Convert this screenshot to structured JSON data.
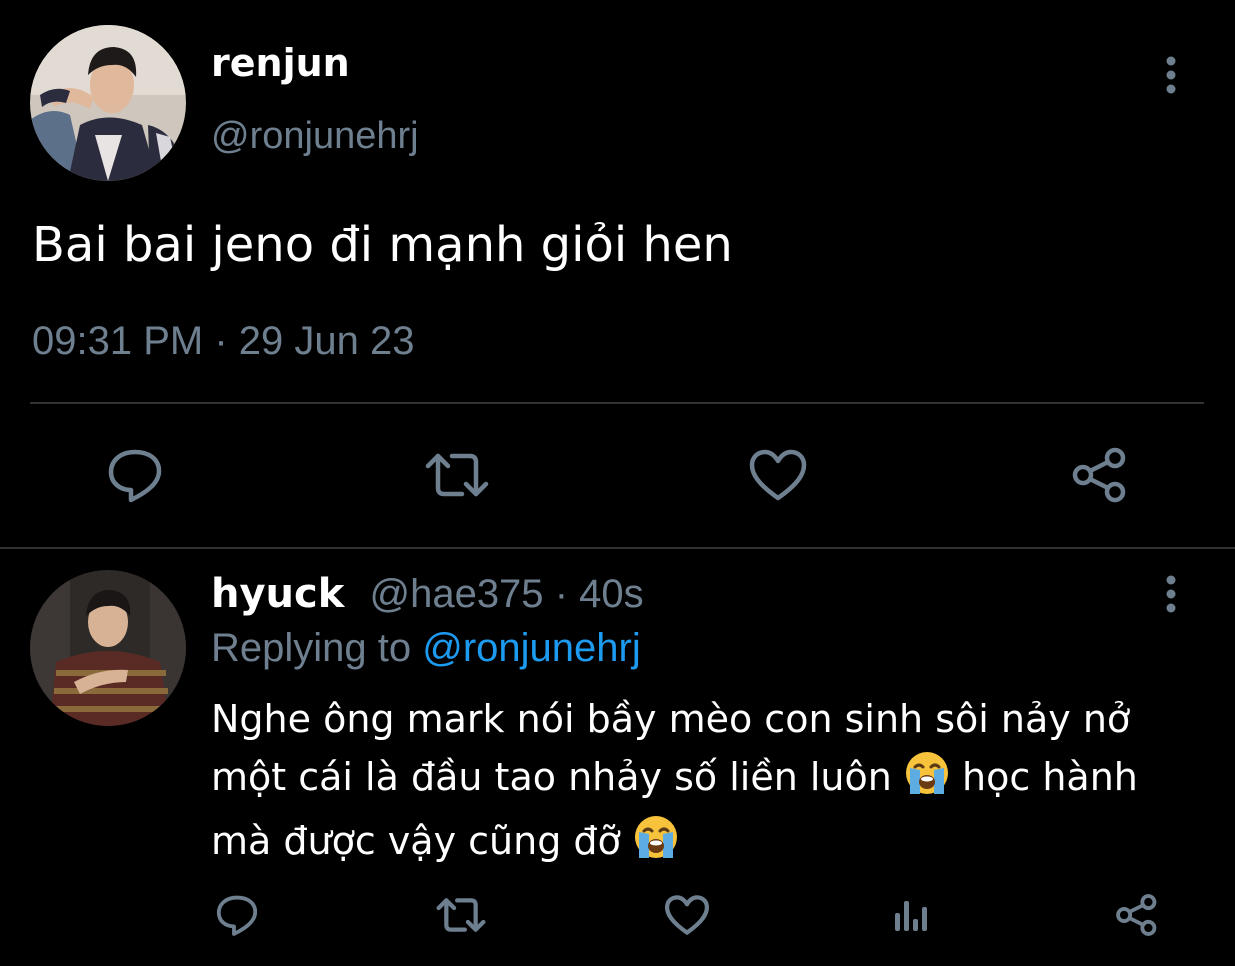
{
  "main_tweet": {
    "author_name": "renjun",
    "author_handle": "@ronjunehrj",
    "text": "Bai bai jeno đi mạnh giỏi hen",
    "timestamp": "09:31 PM · 29 Jun 23",
    "actions": [
      "reply-icon",
      "retweet-icon",
      "like-icon",
      "share-icon"
    ],
    "more_icon": "more-vertical-icon"
  },
  "reply": {
    "author_name": "hyuck",
    "author_handle": "@hae375",
    "time_ago": "· 40s",
    "replying_prefix": "Replying to",
    "replying_handle": "@ronjunehrj",
    "text_line_1": "Nghe ông mark nói bầy mèo con sinh sôi nảy nở",
    "text_line_2a": "một cái là đầu tao nhảy số liền luôn",
    "text_line_2b": "học hành",
    "text_line_3": "mà được vậy cũng đỡ",
    "emoji": "loudly-crying-face",
    "actions": [
      "reply-icon",
      "retweet-icon",
      "like-icon",
      "analytics-icon",
      "share-icon"
    ],
    "more_icon": "more-vertical-icon"
  },
  "colors": {
    "background": "#000000",
    "text": "#ffffff",
    "muted": "#6e7f8f",
    "link": "#1d9bf0",
    "divider": "#2f3336"
  }
}
